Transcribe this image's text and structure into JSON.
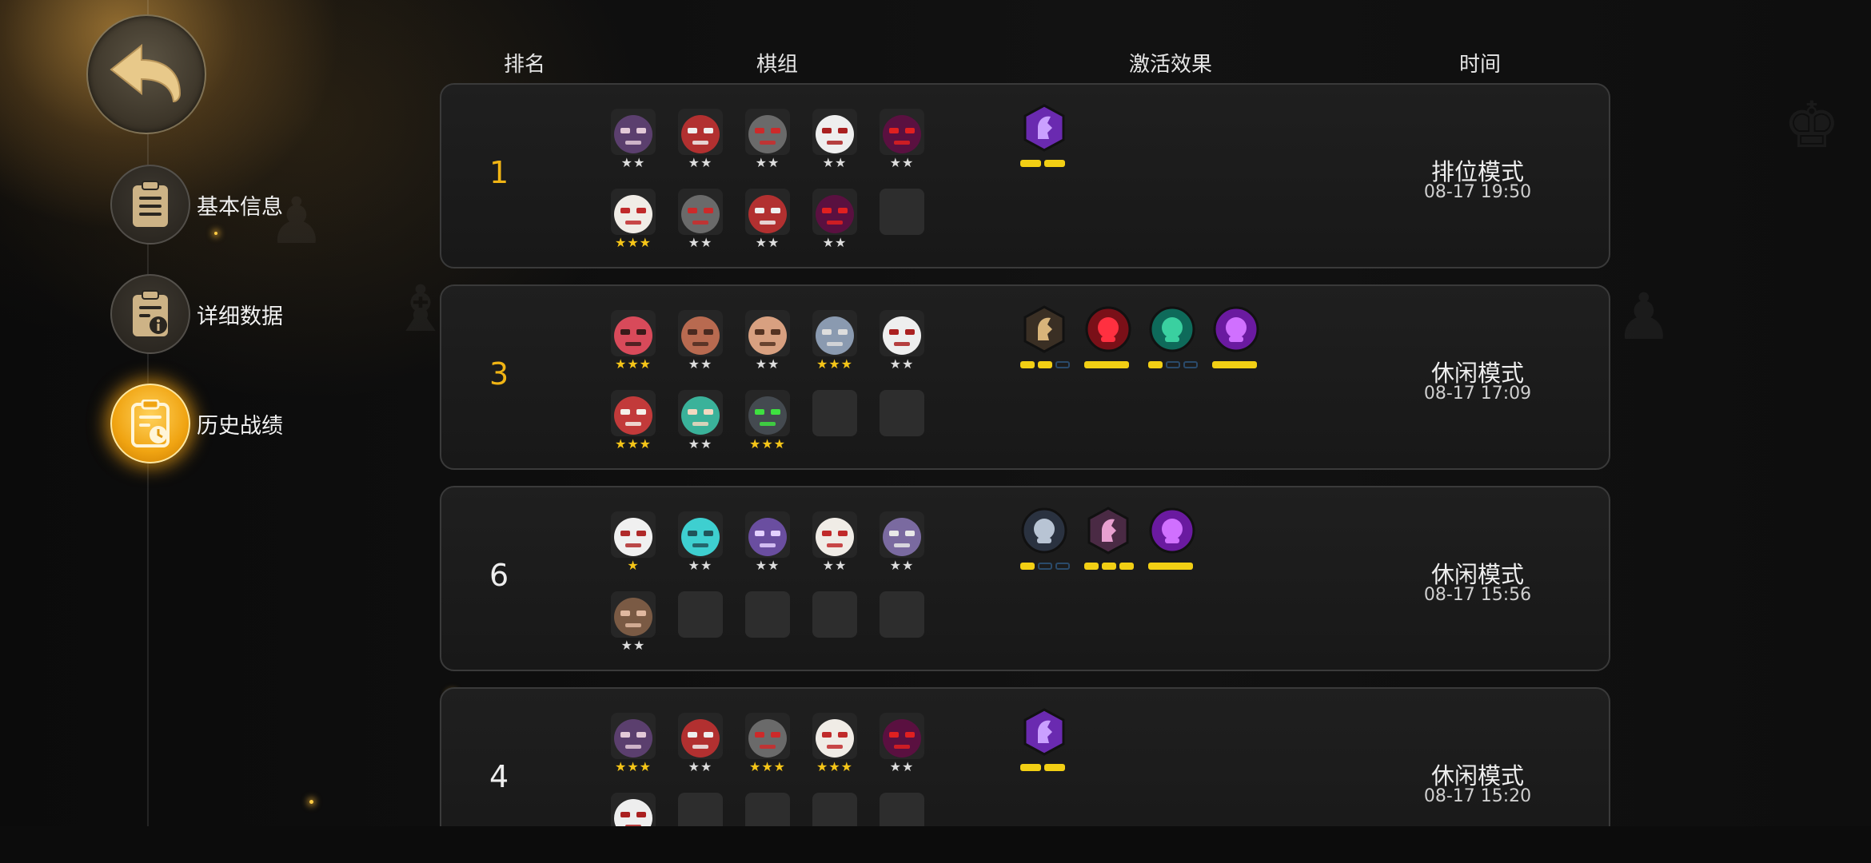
{
  "colors": {
    "gold": "#f0b414",
    "star_gold": "#f5c518",
    "star_white": "#dddddd",
    "bar_yellow": "#f2cf14",
    "bar_dark": "#2a4a6a"
  },
  "nav": {
    "back": "back-arrow-icon",
    "items": [
      {
        "label": "基本信息",
        "icon": "document-icon",
        "active": false
      },
      {
        "label": "详细数据",
        "icon": "info-document-icon",
        "active": false
      },
      {
        "label": "历史战绩",
        "icon": "history-document-icon",
        "active": true
      }
    ]
  },
  "headers": {
    "rank": "排名",
    "lineup": "棋组",
    "effects": "激活效果",
    "time": "时间"
  },
  "matches": [
    {
      "rank": "1",
      "mode": "排位模式",
      "time": "08-17 19:50",
      "lineup_row1": [
        {
          "hero": "helmet-knight",
          "stars": "★★",
          "gold": false
        },
        {
          "hero": "horned-mask",
          "stars": "★★",
          "gold": false
        },
        {
          "hero": "iron-mask",
          "stars": "★★",
          "gold": false
        },
        {
          "hero": "skull-warrior",
          "stars": "★★",
          "gold": false
        },
        {
          "hero": "red-demon",
          "stars": "★★",
          "gold": false
        }
      ],
      "lineup_row2": [
        {
          "hero": "white-beast",
          "stars": "★★★",
          "gold": true
        },
        {
          "hero": "iron-mask",
          "stars": "★★",
          "gold": false
        },
        {
          "hero": "horned-mask",
          "stars": "★★",
          "gold": false
        },
        {
          "hero": "red-demon",
          "stars": "★★",
          "gold": false
        },
        {
          "hero": "",
          "stars": "",
          "gold": false
        }
      ],
      "effects": [
        {
          "icon": "purple-knight-icon",
          "bars": [
            "y",
            "y"
          ]
        }
      ]
    },
    {
      "rank": "3",
      "mode": "休闲模式",
      "time": "08-17 17:09",
      "lineup_row1": [
        {
          "hero": "red-orc",
          "stars": "★★★",
          "gold": true
        },
        {
          "hero": "masked-bandit",
          "stars": "★★",
          "gold": false
        },
        {
          "hero": "goggle-brute",
          "stars": "★★",
          "gold": false
        },
        {
          "hero": "armored-bear",
          "stars": "★★★",
          "gold": true
        },
        {
          "hero": "skull-warrior",
          "stars": "★★",
          "gold": false
        }
      ],
      "lineup_row2": [
        {
          "hero": "chef-beast",
          "stars": "★★★",
          "gold": true
        },
        {
          "hero": "green-hair-girl",
          "stars": "★★",
          "gold": false
        },
        {
          "hero": "cyclops-robot",
          "stars": "★★★",
          "gold": true
        },
        {
          "hero": "",
          "stars": "",
          "gold": false
        },
        {
          "hero": "",
          "stars": "",
          "gold": false
        }
      ],
      "effects": [
        {
          "icon": "axe-shield-icon",
          "bars": [
            "y",
            "y",
            "d"
          ]
        },
        {
          "icon": "red-arc-icon",
          "bars": [
            "w"
          ]
        },
        {
          "icon": "teal-paw-icon",
          "bars": [
            "y",
            "d",
            "d"
          ]
        },
        {
          "icon": "purple-demon-icon",
          "bars": [
            "w"
          ]
        }
      ]
    },
    {
      "rank": "6",
      "mode": "休闲模式",
      "time": "08-17 15:56",
      "lineup_row1": [
        {
          "hero": "white-yeti",
          "stars": "★",
          "gold": true
        },
        {
          "hero": "cyan-robot",
          "stars": "★★",
          "gold": false
        },
        {
          "hero": "purple-bat",
          "stars": "★★",
          "gold": false
        },
        {
          "hero": "white-beast",
          "stars": "★★",
          "gold": false
        },
        {
          "hero": "helmet-girl",
          "stars": "★★",
          "gold": false
        }
      ],
      "lineup_row2": [
        {
          "hero": "bearded-dwarf",
          "stars": "★★",
          "gold": false
        },
        {
          "hero": "",
          "stars": "",
          "gold": false
        },
        {
          "hero": "",
          "stars": "",
          "gold": false
        },
        {
          "hero": "",
          "stars": "",
          "gold": false
        },
        {
          "hero": "",
          "stars": "",
          "gold": false
        }
      ],
      "effects": [
        {
          "icon": "grey-person-icon",
          "bars": [
            "y",
            "d",
            "d"
          ]
        },
        {
          "icon": "pink-horse-icon",
          "bars": [
            "y",
            "y",
            "y"
          ]
        },
        {
          "icon": "purple-demon-icon",
          "bars": [
            "w"
          ]
        }
      ]
    },
    {
      "rank": "4",
      "mode": "休闲模式",
      "time": "08-17 15:20",
      "lineup_row1": [
        {
          "hero": "helmet-knight",
          "stars": "★★★",
          "gold": true
        },
        {
          "hero": "horned-mask",
          "stars": "★★",
          "gold": false
        },
        {
          "hero": "iron-mask",
          "stars": "★★★",
          "gold": true
        },
        {
          "hero": "white-beast",
          "stars": "★★★",
          "gold": true
        },
        {
          "hero": "red-demon",
          "stars": "★★",
          "gold": false
        }
      ],
      "lineup_row2": [
        {
          "hero": "skull-warrior",
          "stars": "",
          "gold": false
        },
        {
          "hero": "",
          "stars": "",
          "gold": false
        },
        {
          "hero": "",
          "stars": "",
          "gold": false
        },
        {
          "hero": "",
          "stars": "",
          "gold": false
        },
        {
          "hero": "",
          "stars": "",
          "gold": false
        }
      ],
      "effects": [
        {
          "icon": "purple-knight-icon",
          "bars": [
            "y",
            "y"
          ]
        }
      ]
    }
  ]
}
